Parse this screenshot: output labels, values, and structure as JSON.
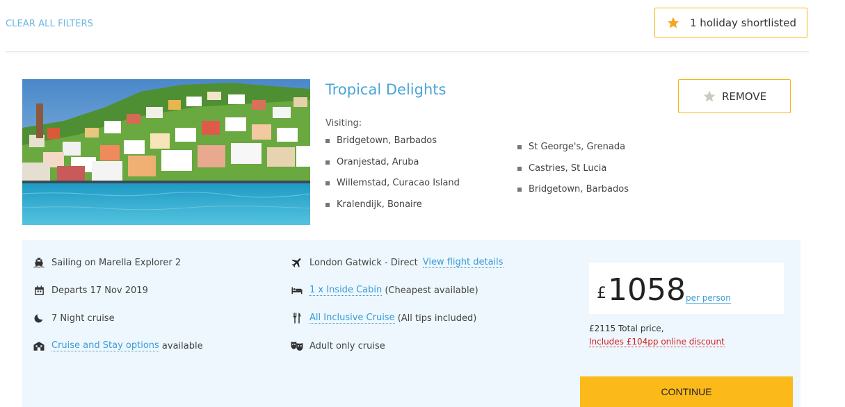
{
  "header": {
    "clear_filters": "CLEAR ALL FILTERS",
    "shortlist_label": "1 holiday shortlisted"
  },
  "holiday": {
    "title": "Tropical Delights",
    "visiting_label": "Visiting:",
    "destinations_col1": [
      "Bridgetown, Barbados",
      "Oranjestad, Aruba",
      "Willemstad, Curacao Island",
      "Kralendijk, Bonaire"
    ],
    "destinations_col2": [
      "St George's, Grenada",
      "Castries, St Lucia",
      "Bridgetown, Barbados"
    ],
    "remove_label": "REMOVE"
  },
  "details": {
    "ship": "Sailing on Marella Explorer 2",
    "departs": "Departs 17 Nov 2019",
    "nights": "7 Night cruise",
    "cruise_stay_link": "Cruise and Stay options",
    "cruise_stay_suffix": " available",
    "flight": "London Gatwick - Direct",
    "flight_link": "View flight details",
    "cabin_link": "1 x Inside Cabin",
    "cabin_suffix": " (Cheapest available)",
    "board_link": "All Inclusive Cruise",
    "board_suffix": " (All tips included)",
    "adult_only": "Adult only cruise"
  },
  "price": {
    "currency": "£",
    "amount": "1058",
    "per_person": "per person",
    "total": "£2115 Total price,",
    "discount": "Includes £104pp online discount",
    "continue_label": "CONTINUE"
  },
  "colors": {
    "accent_blue": "#4aa5d9",
    "cta_yellow": "#fbb91a",
    "star": "#f5a623",
    "star_inactive": "#cfc9bd",
    "discount_red": "#d42020",
    "panel_bg": "#edf7fd"
  }
}
